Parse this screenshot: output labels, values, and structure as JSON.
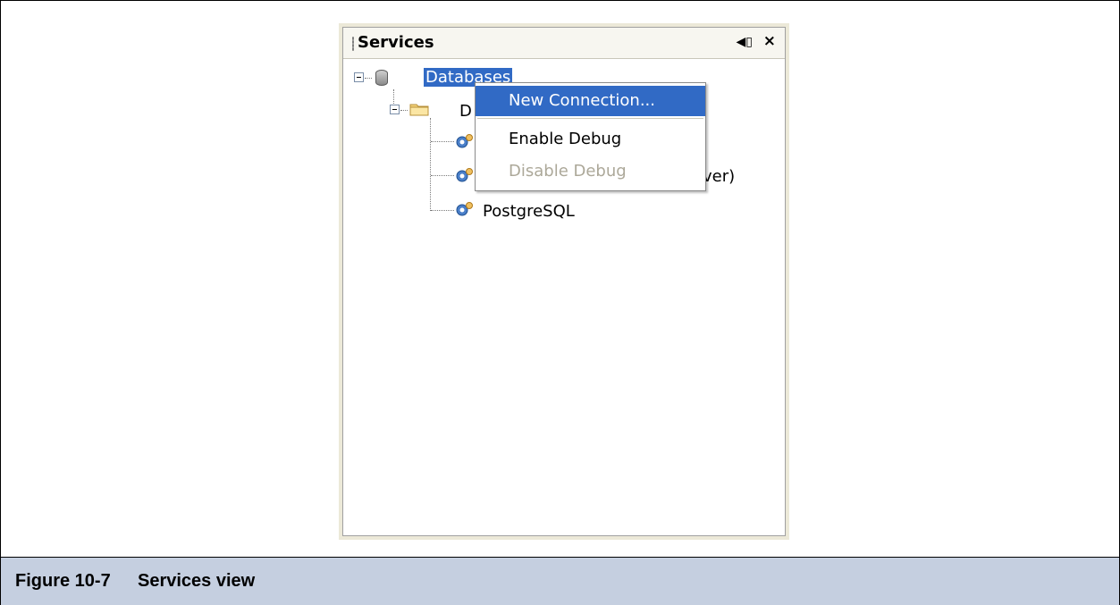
{
  "panel": {
    "title": "Services",
    "minimize_icon": "minimize-icon",
    "close_icon": "close-icon",
    "tree": {
      "root": {
        "label": "Databases",
        "icon": "database-icon"
      },
      "drivers_folder": {
        "label_visible": "D",
        "icon": "folder-icon"
      },
      "items": [
        {
          "label_visible": "ver)",
          "icon": "driver-gear-icon"
        },
        {
          "label": "PostgreSQL",
          "icon": "driver-gear-icon"
        }
      ]
    }
  },
  "context_menu": {
    "items": [
      {
        "label": "New Connection...",
        "state": "highlighted"
      },
      {
        "label": "Enable Debug",
        "state": "enabled"
      },
      {
        "label": "Disable Debug",
        "state": "disabled"
      }
    ]
  },
  "caption": {
    "number": "Figure 10-7",
    "title": "Services view"
  },
  "colors": {
    "selection": "#316ac5",
    "caption_bg": "#c5cfe0",
    "panel_bg": "#ece9d8",
    "disabled_text": "#aca899"
  }
}
